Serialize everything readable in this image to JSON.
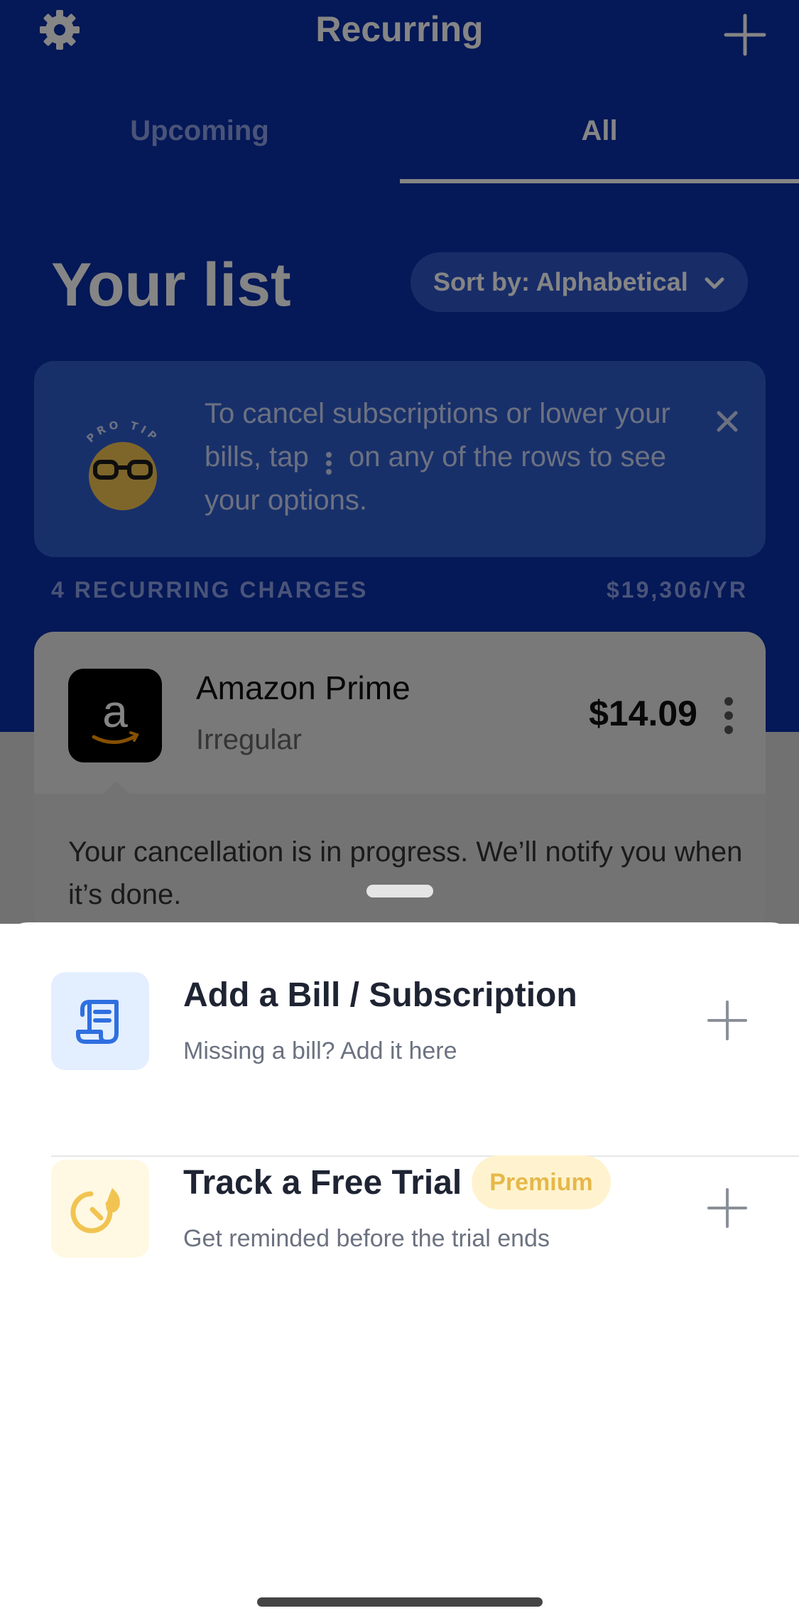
{
  "header": {
    "title": "Recurring"
  },
  "tabs": [
    {
      "label": "Upcoming",
      "active": false
    },
    {
      "label": "All",
      "active": true
    }
  ],
  "list": {
    "heading": "Your list",
    "sort_label": "Sort by: Alphabetical"
  },
  "pro_tip": {
    "badge_text": "PRO TIP",
    "text_before": "To cancel subscriptions or lower your bills, tap",
    "text_after": "on any of the rows to see your options."
  },
  "summary": {
    "count_label": "4 RECURRING CHARGES",
    "total_label": "$19,306/YR"
  },
  "bill": {
    "name": "Amazon Prime",
    "frequency": "Irregular",
    "amount": "$14.09",
    "logo_letter": "a",
    "note": "Your cancellation is in progress. We’ll notify you when it’s done."
  },
  "sheet": {
    "add_bill": {
      "title": "Add a Bill / Subscription",
      "subtitle": "Missing a bill? Add it here"
    },
    "free_trial": {
      "title": "Track a Free Trial",
      "badge": "Premium",
      "subtitle": "Get reminded before the trial ends"
    }
  },
  "colors": {
    "brand_blue": "#0a2fa8",
    "bill_icon_blue": "#2f6fe0",
    "trial_icon_yellow": "#f1c451",
    "premium_bg": "#fff3cf"
  }
}
